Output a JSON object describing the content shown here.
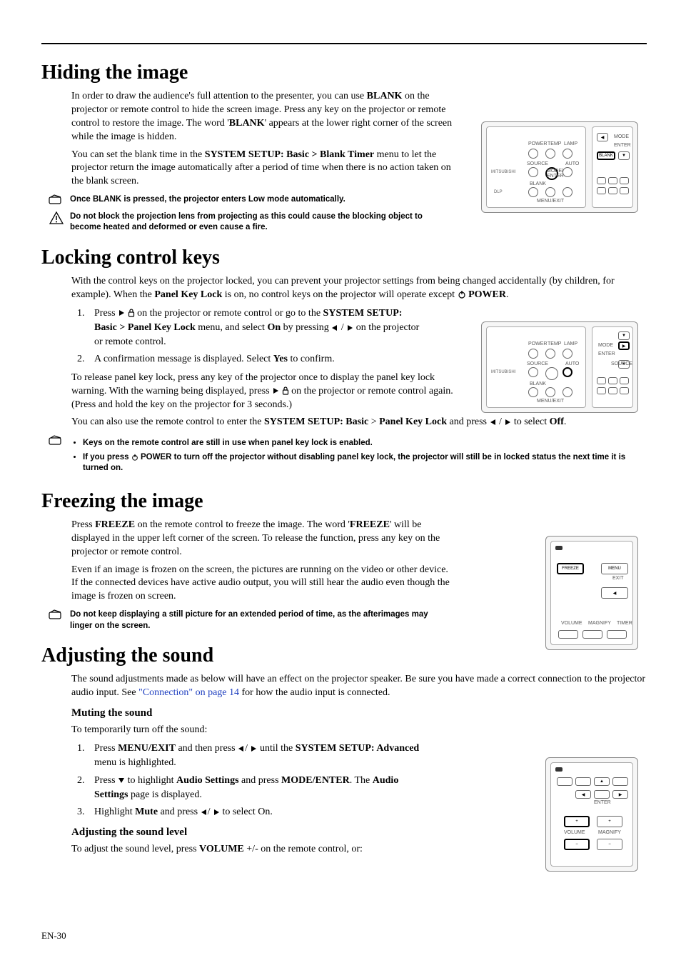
{
  "page_footer": "EN-30",
  "sections": {
    "hiding": {
      "title": "Hiding the image",
      "p1_a": "In order to draw the audience's full attention to the presenter, you can use ",
      "p1_b": "BLANK",
      "p1_c": " on the projector or remote control to hide the screen image. Press any key on the projector or remote control to restore the image. The word '",
      "p1_d": "BLANK",
      "p1_e": "' appears at the lower right corner of the screen while the image is hidden.",
      "p2_a": "You can set the blank time in the ",
      "p2_b": "SYSTEM SETUP: Basic > Blank Timer",
      "p2_c": " menu to let the projector return the image automatically after a period of time when there is no action taken on the blank screen.",
      "note1": "Once BLANK is pressed, the projector enters Low mode automatically.",
      "warn1": "Do not block the projection lens from projecting as this could cause the blocking object to become heated and deformed or even cause a fire."
    },
    "locking": {
      "title": "Locking control keys",
      "p1_a": "With the control keys on the projector locked, you can prevent your projector settings from being changed accidentally (by children, for example). When the ",
      "p1_b": "Panel Key Lock",
      "p1_c": " is on, no control keys on the projector will operate except ",
      "p1_d": "POWER",
      "p1_e": ".",
      "step1_a": "Press ",
      "step1_b": " on the projector or remote control or go to the ",
      "step1_c": "SYSTEM SETUP: Basic > Panel Key Lock",
      "step1_d": " menu, and select ",
      "step1_e": "On",
      "step1_f": " by pressing ",
      "step1_g": " on the projector or remote control.",
      "step2_a": "A confirmation message is displayed. Select ",
      "step2_b": "Yes",
      "step2_c": " to confirm.",
      "p3_a": "To release panel key lock, press any key of the projector once to display the panel key lock warning. With the warning being displayed, press ",
      "p3_b": " on the projector or remote control again. (Press and hold the key on the projector for 3 seconds.)",
      "p4_a": "You can also use the remote control to enter the ",
      "p4_b": "SYSTEM SETUP: Basic",
      "p4_c": " > ",
      "p4_d": "Panel Key Lock",
      "p4_e": " and press ",
      "p4_f": " to select ",
      "p4_g": "Off",
      "p4_h": ".",
      "bullet1": "Keys on the remote control are still in use when panel key lock is enabled.",
      "bullet2_a": "If you press ",
      "bullet2_b": "POWER to turn off the projector without disabling panel key lock, the projector will still be in locked status the next time it is turned on."
    },
    "freezing": {
      "title": "Freezing the image",
      "p1_a": "Press ",
      "p1_b": "FREEZE",
      "p1_c": " on the remote control to freeze the image. The word '",
      "p1_d": "FREEZE",
      "p1_e": "' will be displayed in the upper left corner of the screen. To release the function, press any key on the projector or remote control.",
      "p2": "Even if an image is frozen on the screen, the pictures are running on the video or other device. If the connected devices have active audio output, you will still hear the audio even though the image is frozen on screen.",
      "note1": "Do not keep displaying a still picture for an extended period of time, as the afterimages may linger on the screen."
    },
    "sound": {
      "title": "Adjusting the sound",
      "p1_a": "The sound adjustments made as below will have an effect on the projector speaker. Be sure you have made a correct connection to the projector audio input. See ",
      "p1_link": "\"Connection\" on page 14",
      "p1_b": " for how the audio input is connected.",
      "muting_h": "Muting the sound",
      "muting_p": "To temporarily turn off the sound:",
      "m_step1_a": "Press ",
      "m_step1_b": "MENU/EXIT",
      "m_step1_c": " and then press ",
      "m_step1_d": " until the ",
      "m_step1_e": "SYSTEM SETUP: Advanced",
      "m_step1_f": " menu is highlighted.",
      "m_step2_a": "Press ",
      "m_step2_b": " to highlight ",
      "m_step2_c": "Audio Settings",
      "m_step2_d": " and press ",
      "m_step2_e": "MODE/ENTER",
      "m_step2_f": ". The ",
      "m_step2_g": "Audio Settings",
      "m_step2_h": " page is displayed.",
      "m_step3_a": "Highlight ",
      "m_step3_b": "Mute",
      "m_step3_c": " and press ",
      "m_step3_d": " to select On.",
      "level_h": "Adjusting the sound level",
      "level_p_a": "To adjust the sound level, press ",
      "level_p_b": "VOLUME",
      "level_p_c": " +/- on the remote control, or:"
    }
  },
  "diagram_labels": {
    "power": "POWER",
    "temp": "TEMP",
    "lamp": "LAMP",
    "source": "SOURCE",
    "auto": "AUTO",
    "blank": "BLANK",
    "mode_enter": "MODE/\nENTER",
    "menu_exit": "MENU/EXIT",
    "mitsubishi": "MITSUBISHI",
    "dlp": "DLP",
    "mode": "MODE",
    "enter": "ENTER",
    "freeze": "FREEZE",
    "menu": "MENU",
    "exit": "EXIT",
    "volume": "VOLUME",
    "magnify": "MAGNIFY",
    "timer": "TIMER"
  }
}
